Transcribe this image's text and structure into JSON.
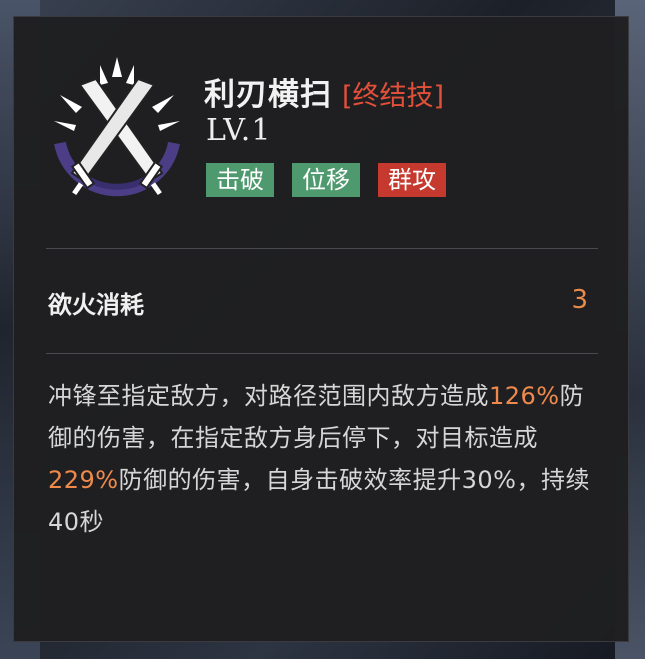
{
  "skill": {
    "name": "利刃横扫",
    "type": "[终结技]",
    "level": "LV.1",
    "icon": "crossed-swords-icon"
  },
  "tags": [
    {
      "label": "击破",
      "color": "#4e9a6e"
    },
    {
      "label": "位移",
      "color": "#4e9a6e"
    },
    {
      "label": "群攻",
      "color": "#c5392e"
    }
  ],
  "cost": {
    "label": "欲火消耗",
    "value": "3"
  },
  "description": {
    "p1": "冲锋至指定敌方，对路径范围内敌方造成",
    "v1": "126%",
    "p2": "防御的伤害，在指定敌方身后停下，对目标造成",
    "v2": "229%",
    "p3": "防御的伤害，自身击破效率提升30%，持续40秒"
  },
  "colors": {
    "accent": "#ef8a4c",
    "type_red": "#e2503a",
    "panel": "#1f1f21"
  }
}
